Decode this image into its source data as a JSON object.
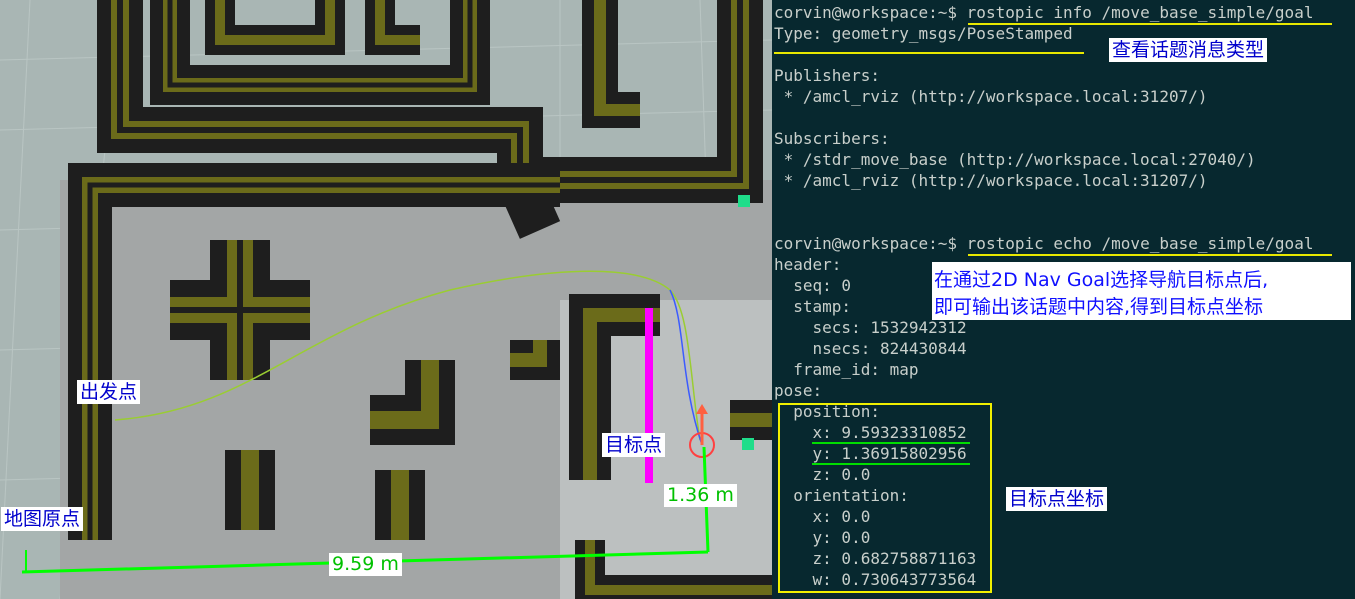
{
  "map": {
    "labels": {
      "start": "出发点",
      "goal": "目标点",
      "origin": "地图原点"
    },
    "measurements": {
      "x_distance": "9.59 m",
      "y_distance": "1.36 m"
    },
    "colors": {
      "wall": "#1e1e1e",
      "inflation": "#6b6b1a",
      "floor": "#a5a8a8",
      "path": "#9acd32",
      "goal_marker": "#ff00ff",
      "measure_line": "#00ff00"
    }
  },
  "terminal": {
    "prompt": "corvin@workspace:~$",
    "cmd1": "rostopic info /move_base_simple/goal",
    "info_lines": [
      "Type: geometry_msgs/PoseStamped",
      "",
      "Publishers:",
      " * /amcl_rviz (http://workspace.local:31207/)",
      "",
      "Subscribers:",
      " * /stdr_move_base (http://workspace.local:27040/)",
      " * /amcl_rviz (http://workspace.local:31207/)"
    ],
    "cmd2": "rostopic echo /move_base_simple/goal",
    "echo_lines": [
      "header:",
      "  seq: 0",
      "  stamp:",
      "    secs: 1532942312",
      "    nsecs: 824430844",
      "  frame_id: map",
      "pose:",
      "  position:",
      "    x: 9.59323310852",
      "    y: 1.36915802956",
      "    z: 0.0",
      "  orientation:",
      "    x: 0.0",
      "    y: 0.0",
      "    z: 0.682758871163",
      "    w: 0.730643773564"
    ],
    "annotations": {
      "type_note": "查看话题消息类型",
      "echo_note_1": "在通过2D Nav Goal选择导航目标点后,",
      "echo_note_2": "即可输出该话题中内容,得到目标点坐标",
      "coord_note": "目标点坐标"
    },
    "colors": {
      "bg": "#07282f",
      "text": "#c8cfcb",
      "underline": "#e8e800",
      "highlight_box": "#f0f000"
    }
  }
}
